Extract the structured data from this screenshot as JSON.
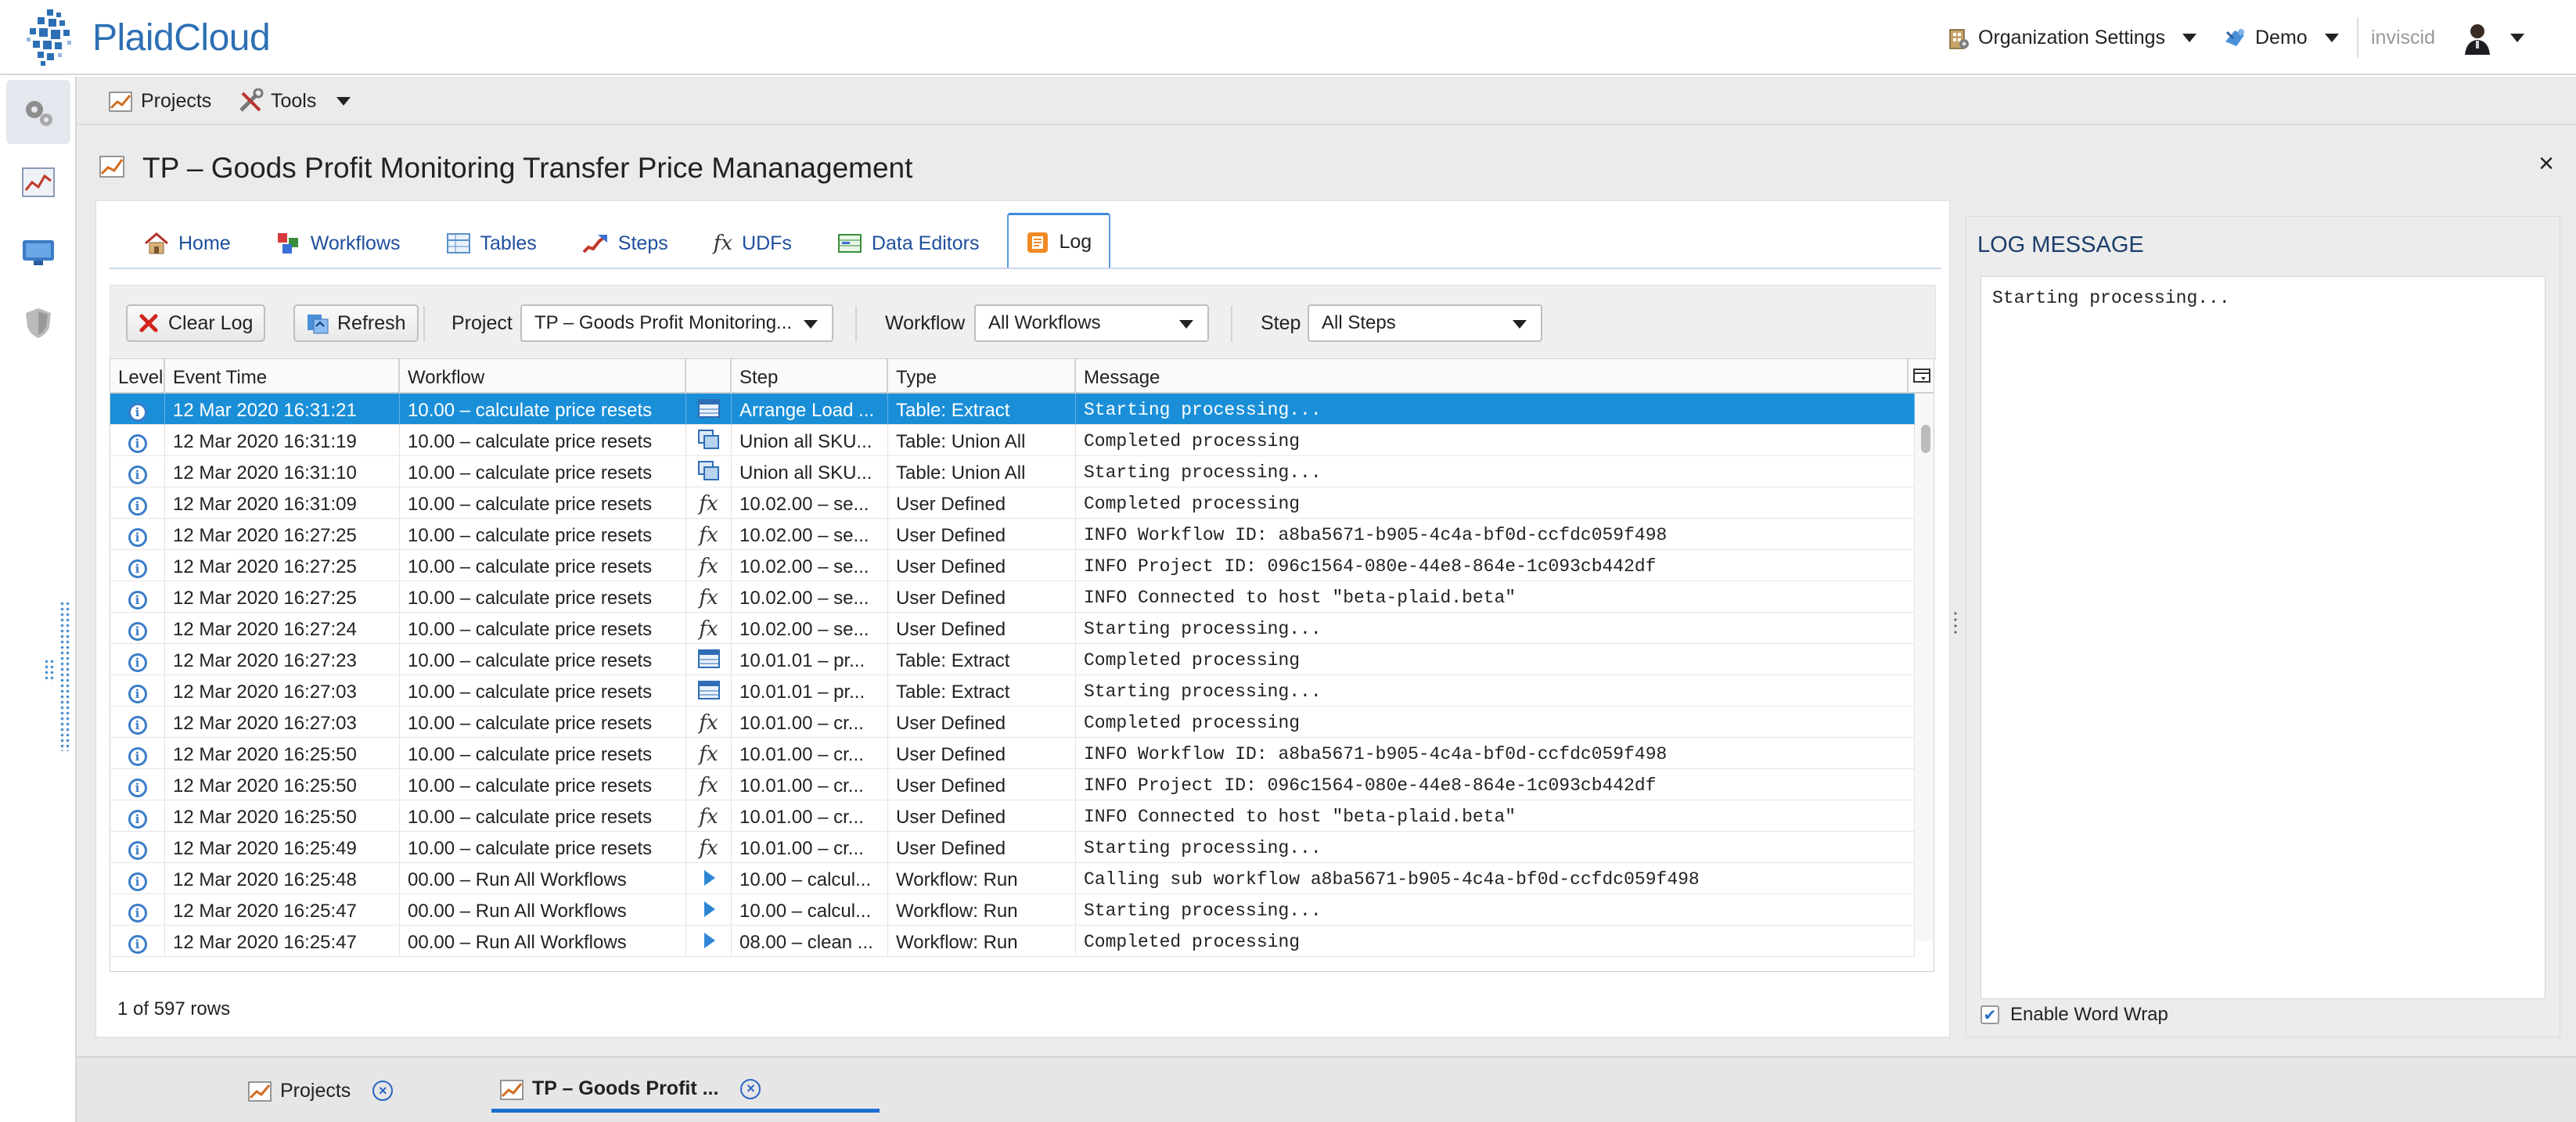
{
  "header": {
    "logo_text": "PlaidCloud",
    "org_settings_label": "Organization Settings",
    "workspace_label": "Demo",
    "user_label": "inviscid"
  },
  "toolbar": {
    "projects_label": "Projects",
    "tools_label": "Tools"
  },
  "page": {
    "title": "TP – Goods Profit Monitoring Transfer Price Mananagement",
    "close_glyph": "×"
  },
  "tabs": [
    {
      "label": "Home",
      "icon": "home-icon"
    },
    {
      "label": "Workflows",
      "icon": "workflows-icon"
    },
    {
      "label": "Tables",
      "icon": "tables-icon"
    },
    {
      "label": "Steps",
      "icon": "steps-icon"
    },
    {
      "label": "UDFs",
      "icon": "fx-icon"
    },
    {
      "label": "Data Editors",
      "icon": "data-editors-icon"
    },
    {
      "label": "Log",
      "icon": "log-icon",
      "active": true
    }
  ],
  "filters": {
    "clear_log_label": "Clear Log",
    "refresh_label": "Refresh",
    "project_label": "Project",
    "project_value": "TP – Goods Profit Monitoring...",
    "workflow_label": "Workflow",
    "workflow_value": "All Workflows",
    "step_label": "Step",
    "step_value": "All Steps"
  },
  "grid": {
    "columns": [
      "Level",
      "Event Time",
      "Workflow",
      "",
      "Step",
      "Type",
      "Message"
    ],
    "rows": [
      {
        "time": "12 Mar 2020 16:31:21",
        "workflow": "10.00 – calculate price resets",
        "icon": "table",
        "step": "Arrange Load ...",
        "type": "Table: Extract",
        "message": "Starting processing...",
        "selected": true
      },
      {
        "time": "12 Mar 2020 16:31:19",
        "workflow": "10.00 – calculate price resets",
        "icon": "union",
        "step": "Union all SKU...",
        "type": "Table: Union All",
        "message": "Completed processing"
      },
      {
        "time": "12 Mar 2020 16:31:10",
        "workflow": "10.00 – calculate price resets",
        "icon": "union",
        "step": "Union all SKU...",
        "type": "Table: Union All",
        "message": "Starting processing..."
      },
      {
        "time": "12 Mar 2020 16:31:09",
        "workflow": "10.00 – calculate price resets",
        "icon": "fx",
        "step": "10.02.00 – se...",
        "type": "User Defined",
        "message": "Completed processing"
      },
      {
        "time": "12 Mar 2020 16:27:25",
        "workflow": "10.00 – calculate price resets",
        "icon": "fx",
        "step": "10.02.00 – se...",
        "type": "User Defined",
        "message": "INFO Workflow ID: a8ba5671-b905-4c4a-bf0d-ccfdc059f498"
      },
      {
        "time": "12 Mar 2020 16:27:25",
        "workflow": "10.00 – calculate price resets",
        "icon": "fx",
        "step": "10.02.00 – se...",
        "type": "User Defined",
        "message": "INFO Project ID: 096c1564-080e-44e8-864e-1c093cb442df"
      },
      {
        "time": "12 Mar 2020 16:27:25",
        "workflow": "10.00 – calculate price resets",
        "icon": "fx",
        "step": "10.02.00 – se...",
        "type": "User Defined",
        "message": "INFO Connected to host \"beta-plaid.beta\""
      },
      {
        "time": "12 Mar 2020 16:27:24",
        "workflow": "10.00 – calculate price resets",
        "icon": "fx",
        "step": "10.02.00 – se...",
        "type": "User Defined",
        "message": "Starting processing..."
      },
      {
        "time": "12 Mar 2020 16:27:23",
        "workflow": "10.00 – calculate price resets",
        "icon": "table",
        "step": "10.01.01 – pr...",
        "type": "Table: Extract",
        "message": "Completed processing"
      },
      {
        "time": "12 Mar 2020 16:27:03",
        "workflow": "10.00 – calculate price resets",
        "icon": "table",
        "step": "10.01.01 – pr...",
        "type": "Table: Extract",
        "message": "Starting processing..."
      },
      {
        "time": "12 Mar 2020 16:27:03",
        "workflow": "10.00 – calculate price resets",
        "icon": "fx",
        "step": "10.01.00 – cr...",
        "type": "User Defined",
        "message": "Completed processing"
      },
      {
        "time": "12 Mar 2020 16:25:50",
        "workflow": "10.00 – calculate price resets",
        "icon": "fx",
        "step": "10.01.00 – cr...",
        "type": "User Defined",
        "message": "INFO Workflow ID: a8ba5671-b905-4c4a-bf0d-ccfdc059f498"
      },
      {
        "time": "12 Mar 2020 16:25:50",
        "workflow": "10.00 – calculate price resets",
        "icon": "fx",
        "step": "10.01.00 – cr...",
        "type": "User Defined",
        "message": "INFO Project ID: 096c1564-080e-44e8-864e-1c093cb442df"
      },
      {
        "time": "12 Mar 2020 16:25:50",
        "workflow": "10.00 – calculate price resets",
        "icon": "fx",
        "step": "10.01.00 – cr...",
        "type": "User Defined",
        "message": "INFO Connected to host \"beta-plaid.beta\""
      },
      {
        "time": "12 Mar 2020 16:25:49",
        "workflow": "10.00 – calculate price resets",
        "icon": "fx",
        "step": "10.01.00 – cr...",
        "type": "User Defined",
        "message": "Starting processing..."
      },
      {
        "time": "12 Mar 2020 16:25:48",
        "workflow": "00.00 – Run All Workflows",
        "icon": "run",
        "step": "10.00 – calcul...",
        "type": "Workflow: Run",
        "message": "Calling sub workflow a8ba5671-b905-4c4a-bf0d-ccfdc059f498"
      },
      {
        "time": "12 Mar 2020 16:25:47",
        "workflow": "00.00 – Run All Workflows",
        "icon": "run",
        "step": "10.00 – calcul...",
        "type": "Workflow: Run",
        "message": "Starting processing..."
      },
      {
        "time": "12 Mar 2020 16:25:47",
        "workflow": "00.00 – Run All Workflows",
        "icon": "run",
        "step": "08.00 – clean ...",
        "type": "Workflow: Run",
        "message": "Completed processing"
      }
    ],
    "row_count": "1 of 597 rows"
  },
  "log_panel": {
    "title": "LOG MESSAGE",
    "message": "Starting processing...",
    "word_wrap_label": "Enable Word Wrap",
    "word_wrap_checked": true
  },
  "bottom_tabs": [
    {
      "label": "Projects"
    },
    {
      "label": "TP – Goods Profit ...",
      "active": true
    }
  ],
  "colors": {
    "accent": "#1a8fd8",
    "brand": "#2d6fb4",
    "link": "#1e4f9c"
  }
}
